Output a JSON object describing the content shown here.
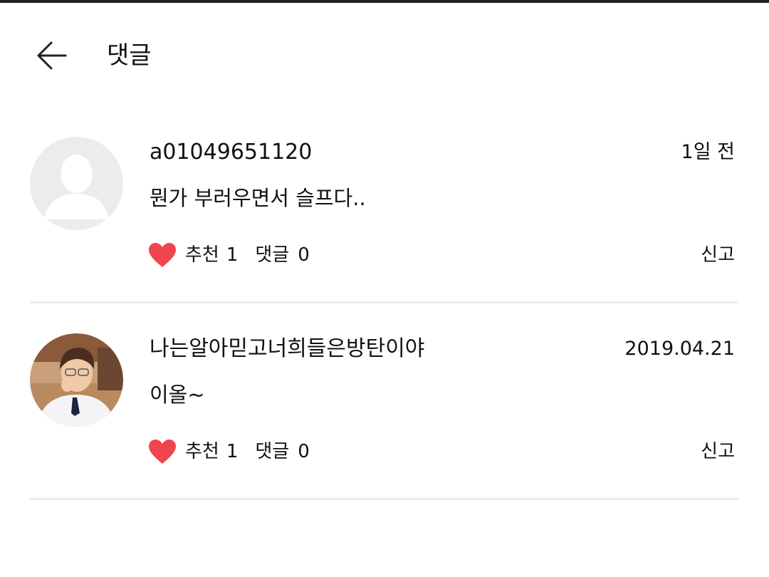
{
  "header": {
    "title": "댓글"
  },
  "comments": [
    {
      "username": "a01049651120",
      "timestamp": "1일 전",
      "text": "뭔가 부러우면서 슬프다..",
      "like_label": "추천",
      "like_count": "1",
      "reply_label": "댓글",
      "reply_count": "0",
      "report_label": "신고",
      "avatar": "default-avatar"
    },
    {
      "username": "나는알아믿고너희들은방탄이야",
      "timestamp": "2019.04.21",
      "text": "이올~",
      "like_label": "추천",
      "like_count": "1",
      "reply_label": "댓글",
      "reply_count": "0",
      "report_label": "신고",
      "avatar": "photo-avatar"
    }
  ],
  "colors": {
    "heart": "#f0454f",
    "divider": "#ececec",
    "text": "#111111"
  }
}
